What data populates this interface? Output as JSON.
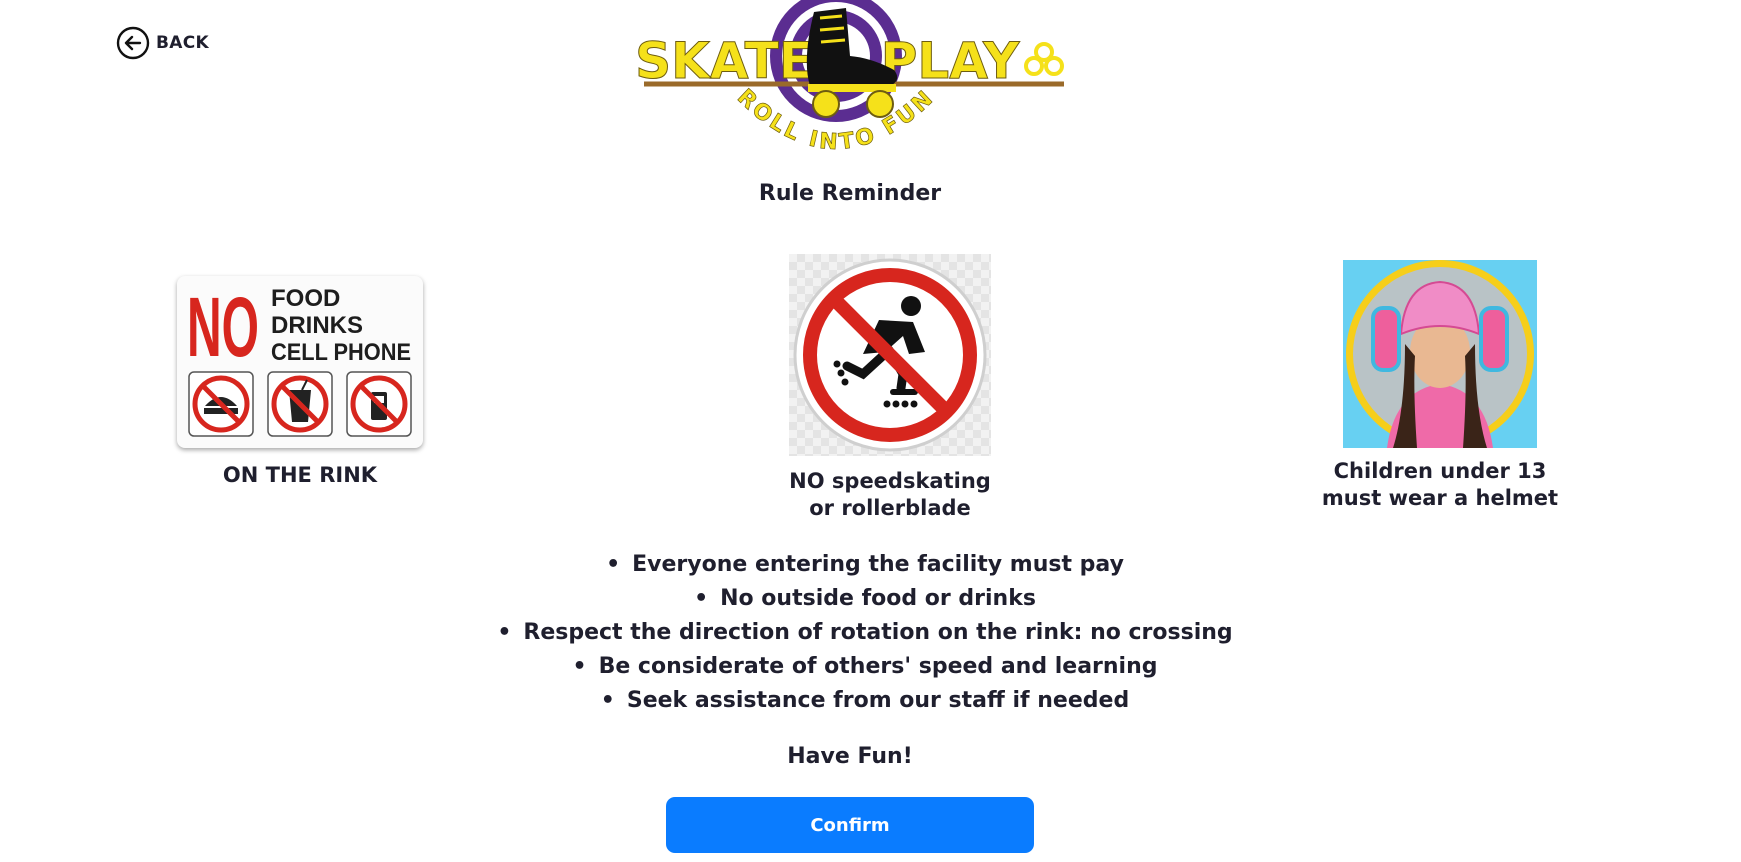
{
  "nav": {
    "back_label": "BACK"
  },
  "logo": {
    "word_left": "SKATE",
    "word_right": "PLAY",
    "tagline": "ROLL INTO FUN"
  },
  "heading": "Rule Reminder",
  "cards": {
    "food": {
      "sign_big": "NO",
      "sign_lines": [
        "FOOD",
        "DRINKS",
        "CELL PHONE"
      ],
      "caption": "ON THE RINK"
    },
    "speed": {
      "caption_line1": "NO speedskating",
      "caption_line2": "or rollerblade"
    },
    "helmet": {
      "caption_line1": "Children under 13",
      "caption_line2": "must wear a helmet"
    }
  },
  "rules": [
    "Everyone entering the facility must pay",
    "No outside food or drinks",
    "Respect the direction of rotation on the rink: no crossing",
    "Be considerate of others' speed and learning",
    "Seek assistance from our staff if needed"
  ],
  "closing": "Have Fun!",
  "confirm_label": "Confirm",
  "colors": {
    "confirm_button": "#0a7cff",
    "logo_yellow": "#f5e11a",
    "logo_purple": "#5b2d91",
    "sign_red": "#d7261e"
  }
}
